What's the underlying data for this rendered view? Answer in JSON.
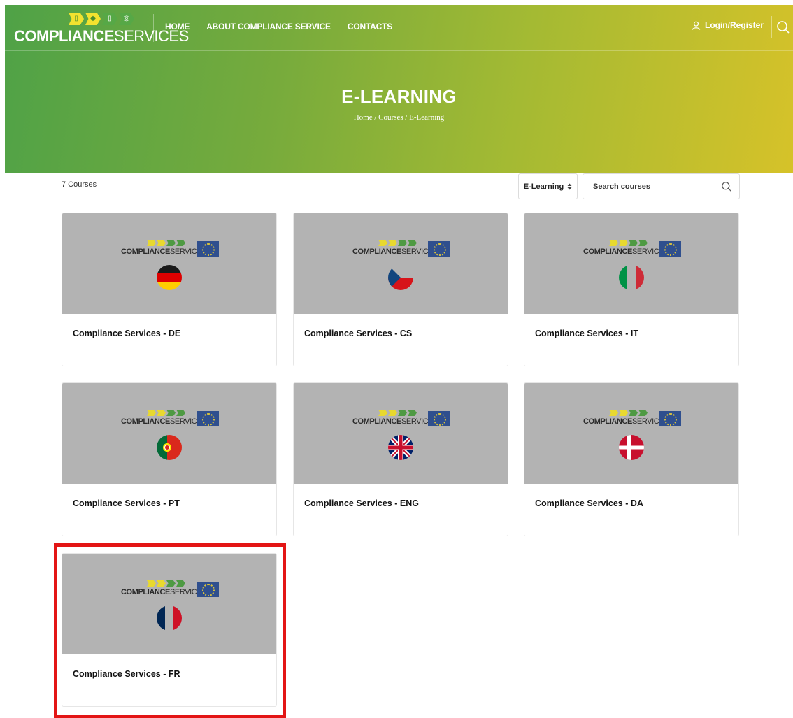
{
  "brand": {
    "logo_bold": "COMPLIANCE",
    "logo_light": "SERVICES"
  },
  "nav": {
    "items": [
      "HOME",
      "ABOUT COMPLIANCE SERVICE",
      "CONTACTS"
    ],
    "login_label": "Login/Register"
  },
  "hero": {
    "title": "E-LEARNING",
    "breadcrumb": "Home / Courses / E-Learning"
  },
  "toolbar": {
    "count_label": "7 Courses",
    "category_selected": "E-Learning",
    "search_placeholder": "Search courses"
  },
  "courses": [
    {
      "title": "Compliance Services - DE",
      "flag": "germany-flag"
    },
    {
      "title": "Compliance Services - CS",
      "flag": "czech-flag"
    },
    {
      "title": "Compliance Services - IT",
      "flag": "italy-flag"
    },
    {
      "title": "Compliance Services - PT",
      "flag": "portugal-flag"
    },
    {
      "title": "Compliance Services - ENG",
      "flag": "uk-flag"
    },
    {
      "title": "Compliance Services - DA",
      "flag": "denmark-flag"
    },
    {
      "title": "Compliance Services - FR",
      "flag": "france-flag"
    }
  ],
  "highlight": {
    "color": "#e31515",
    "target": "Compliance Services - FR"
  }
}
